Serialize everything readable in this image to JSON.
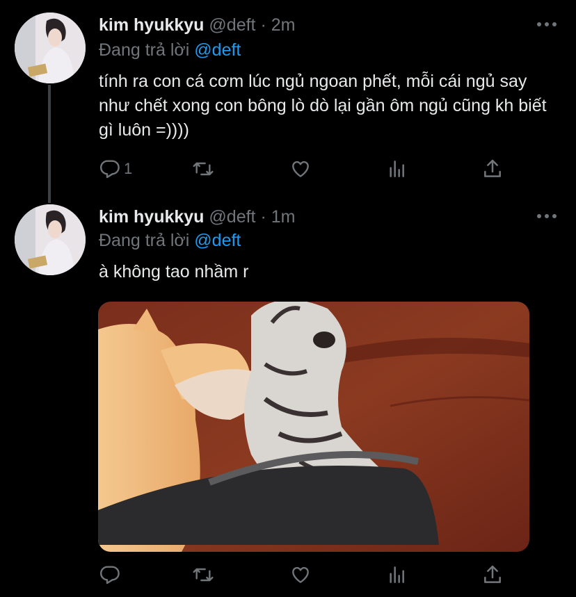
{
  "tweets": [
    {
      "author_name": "kim hyukkyu",
      "handle": "@deft",
      "separator": "·",
      "time": "2m",
      "reply_prefix": "Đang trả lời",
      "reply_mention": "@deft",
      "text": "tính ra con cá cơm lúc ngủ ngoan phết, mỗi cái ngủ say như chết xong con bông lò dò lại gần ôm ngủ cũng kh biết gì luôn =))))",
      "reply_count": "1"
    },
    {
      "author_name": "kim hyukkyu",
      "handle": "@deft",
      "separator": "·",
      "time": "1m",
      "reply_prefix": "Đang trả lời",
      "reply_mention": "@deft",
      "text": "à không tao nhầm r"
    }
  ],
  "colors": {
    "background": "#000000",
    "text": "#e7e9ea",
    "muted": "#71767b",
    "accent": "#1d9bf0"
  },
  "icons": [
    "more-icon",
    "reply-icon",
    "retweet-icon",
    "like-icon",
    "analytics-icon",
    "share-icon"
  ]
}
